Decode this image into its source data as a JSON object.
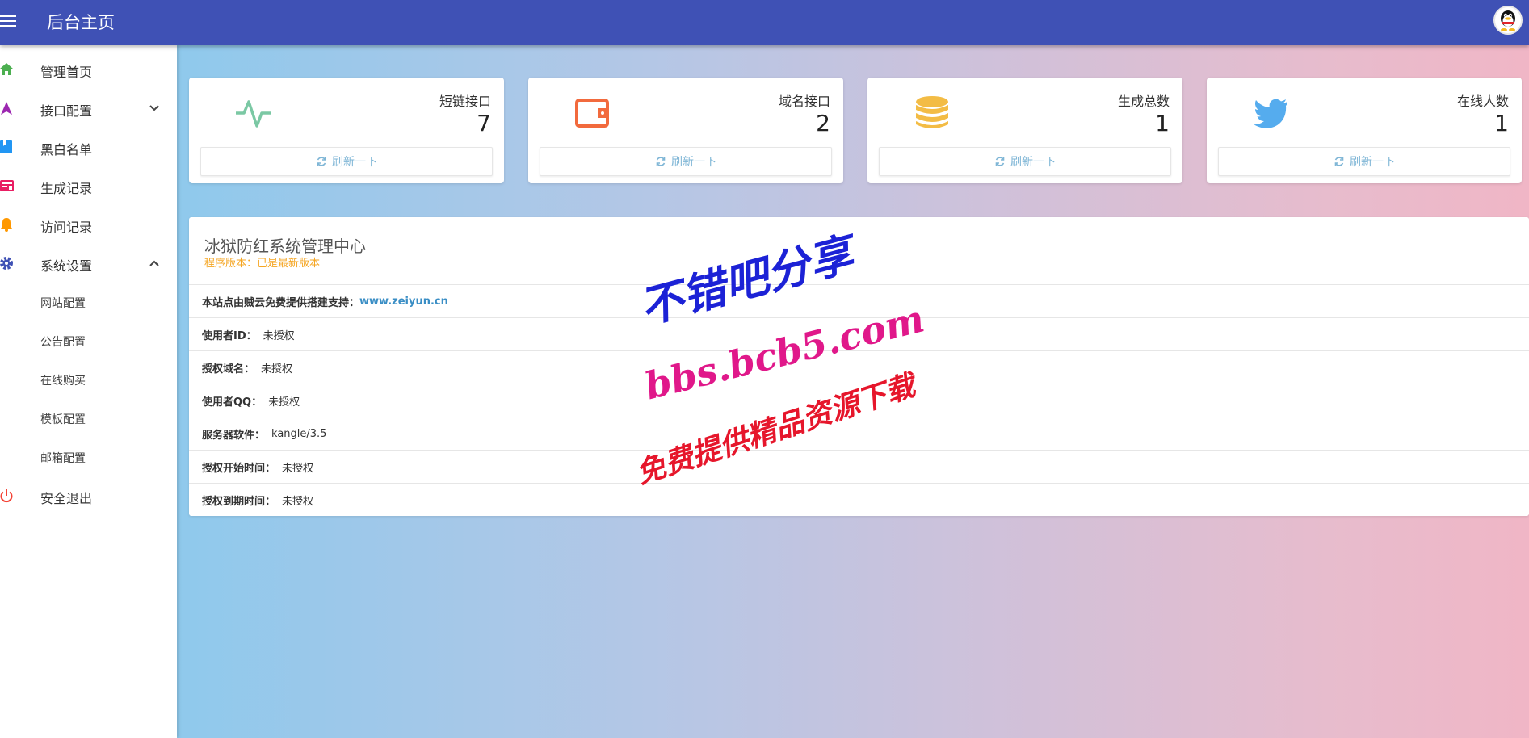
{
  "header": {
    "title": "后台主页"
  },
  "sidebar": {
    "items": [
      {
        "label": "管理首页",
        "icon": "home-icon",
        "color": "#4caf50"
      },
      {
        "label": "接口配置",
        "icon": "navigation-icon",
        "color": "#9c27b0",
        "expanded": false
      },
      {
        "label": "黑白名单",
        "icon": "bookmark-icon",
        "color": "#2196f3"
      },
      {
        "label": "生成记录",
        "icon": "list-icon",
        "color": "#e91e63"
      },
      {
        "label": "访问记录",
        "icon": "bell-icon",
        "color": "#ff9800"
      },
      {
        "label": "系统设置",
        "icon": "gear-icon",
        "color": "#3f51b5",
        "expanded": true
      },
      {
        "label": "安全退出",
        "icon": "power-icon",
        "color": "#f44336"
      }
    ],
    "subitems": [
      "网站配置",
      "公告配置",
      "在线购买",
      "模板配置",
      "邮箱配置"
    ]
  },
  "cards": [
    {
      "label": "短链接口",
      "value": "7",
      "icon": "activity-icon",
      "color": "#7bc8a4",
      "button": "刷新一下"
    },
    {
      "label": "域名接口",
      "value": "2",
      "icon": "wallet-icon",
      "color": "#f26a3d",
      "button": "刷新一下"
    },
    {
      "label": "生成总数",
      "value": "1",
      "icon": "database-icon",
      "color": "#f3bc45",
      "button": "刷新一下"
    },
    {
      "label": "在线人数",
      "value": "1",
      "icon": "twitter-icon",
      "color": "#55acee",
      "button": "刷新一下"
    }
  ],
  "panel": {
    "title": "冰狱防红系统管理中心",
    "subtitle": "程序版本：已是最新版本",
    "rows": [
      {
        "key": "本站点由贼云免费提供搭建支持：",
        "value": "www.zeiyun.cn"
      },
      {
        "key": "使用者ID：",
        "value": "未授权"
      },
      {
        "key": "授权域名：",
        "value": "未授权"
      },
      {
        "key": "使用者QQ：",
        "value": "未授权"
      },
      {
        "key": "服务器软件：",
        "value": "kangle/3.5"
      },
      {
        "key": "授权开始时间：",
        "value": "未授权"
      },
      {
        "key": "授权到期时间：",
        "value": "未授权"
      }
    ]
  },
  "watermark": {
    "line1": "不错吧分享",
    "line2": "bbs.bcb5.com",
    "line3": "免费提供精品资源下载"
  }
}
